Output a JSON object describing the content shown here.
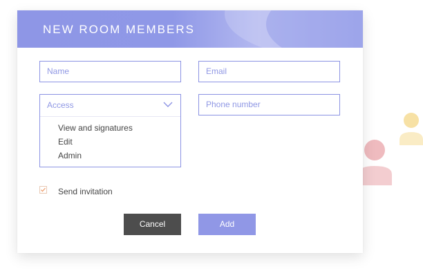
{
  "dialog": {
    "title": "NEW ROOM MEMBERS",
    "fields": {
      "name_placeholder": "Name",
      "email_placeholder": "Email",
      "phone_placeholder": "Phone number"
    },
    "access": {
      "label": "Access",
      "options": [
        "View and signatures",
        "Edit",
        "Admin"
      ]
    },
    "send_invitation": {
      "label": "Send invitation",
      "checked": true
    },
    "buttons": {
      "cancel": "Cancel",
      "add": "Add"
    }
  },
  "colors": {
    "accent": "#8e96e6",
    "cancel_button": "#4d4d4d",
    "checkbox": "#f0a070",
    "avatar_red": "#eaa4aa",
    "avatar_yellow": "#f6dc95"
  },
  "icons": [
    "chevron-down-icon",
    "checkmark-icon",
    "user-avatar-red-icon",
    "user-avatar-yellow-icon"
  ]
}
